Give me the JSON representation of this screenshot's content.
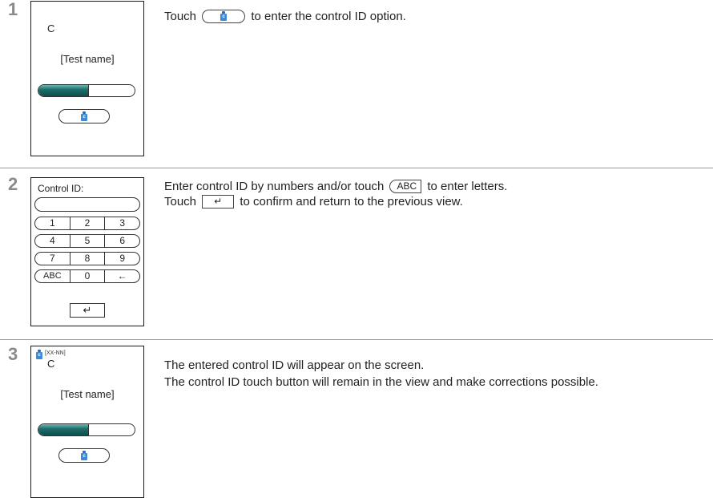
{
  "steps": [
    {
      "number": "1",
      "screen": {
        "c_label": "C",
        "test_name": "[Test name]",
        "progress": 0.52,
        "button_icon": "c",
        "button_icon_name": "control-bottle-icon"
      },
      "instruction": {
        "before": "Touch",
        "after": "to enter the control ID option."
      }
    },
    {
      "number": "2",
      "keypad": {
        "label": "Control ID:",
        "rows": [
          [
            "1",
            "2",
            "3"
          ],
          [
            "4",
            "5",
            "6"
          ],
          [
            "7",
            "8",
            "9"
          ],
          [
            "ABC",
            "0",
            "←"
          ]
        ],
        "enter": "↵"
      },
      "instruction": {
        "line1_before": "Enter control ID by numbers and/or touch",
        "line1_chip": "ABC",
        "line1_after": "to enter letters.",
        "line2_before": "Touch",
        "line2_chip": "↵",
        "line2_after": "to confirm and return to the previous view."
      }
    },
    {
      "number": "3",
      "screen": {
        "tag": "[XX-NN]",
        "c_label": "C",
        "test_name": "[Test name]",
        "progress": 0.52,
        "button_icon": "c"
      },
      "instruction": {
        "line1": "The entered control ID will appear on the screen.",
        "line2": "The control ID touch button will remain in the view and make corrections possible."
      }
    }
  ],
  "colors": {
    "progress_fill": "#1d6f6c",
    "bottle": "#3c8ad9",
    "step_number": "#8a8a8a"
  }
}
